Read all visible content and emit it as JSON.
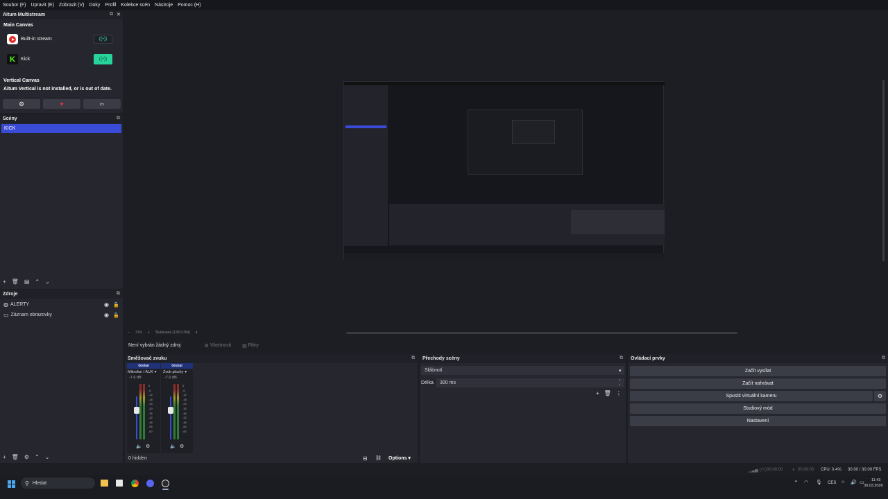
{
  "menubar": {
    "items": [
      "Soubor (F)",
      "Upravit (E)",
      "Zobrazit (V)",
      "Doky",
      "Profil",
      "Kolekce scén",
      "Nástroje",
      "Pomoc (H)"
    ]
  },
  "multistream": {
    "title": "Aitum Multistream",
    "main_canvas_label": "Main Canvas",
    "outputs": [
      {
        "name": "Built-in stream",
        "icon": "youtube-icon",
        "active": false
      },
      {
        "name": "Kick",
        "icon": "kick-icon",
        "active": true
      }
    ],
    "vertical_canvas_label": "Vertical Canvas",
    "vertical_warning": "Aitum Vertical is not installed, or is out of date.",
    "bottom_icons": [
      "gear-icon",
      "heart-icon",
      "share-icon"
    ],
    "accent": "#27d49b"
  },
  "scenes": {
    "title": "Scény",
    "items": [
      "KICK"
    ],
    "selected": "KICK",
    "selected_color": "#3a4bd8"
  },
  "sources": {
    "title": "Zdroje",
    "items": [
      {
        "name": "ALERTY",
        "icon": "globe-icon"
      },
      {
        "name": "Záznam obrazovky",
        "icon": "monitor-icon"
      }
    ]
  },
  "preview": {
    "zoom": "72%",
    "scale_label": "Škálovaná (1367x769)"
  },
  "source_bar": {
    "no_source": "Není vybrán žádný zdroj",
    "properties": "Vlastnosti",
    "filters": "Filtry"
  },
  "mixer": {
    "title": "Směšovač zvuku",
    "channels": [
      {
        "tag": "Global",
        "name": "Mikrofon / AUX",
        "db": "-7.6 dB"
      },
      {
        "tag": "Global",
        "name": "Zvuk plochy",
        "db": "-7.0 dB"
      }
    ],
    "scale": [
      "0",
      "-6",
      "-12",
      "-18",
      "-24",
      "-30",
      "-36",
      "-42",
      "-48",
      "-54",
      "-60"
    ],
    "hidden": "0 hidden",
    "options": "Options"
  },
  "transitions": {
    "title": "Přechody scény",
    "type": "Slábnutí",
    "duration_label": "Délka",
    "duration_value": "300 ms"
  },
  "controls": {
    "title": "Ovládací prvky",
    "buttons": [
      "Začít vysílat",
      "Začít nahrávat",
      "Spustit virtuální kameru",
      "Studiový mód",
      "Nastavení"
    ]
  },
  "status": {
    "stream_time": "00:00:00",
    "rec_time": "00:00:00",
    "cpu": "CPU: 0.4%",
    "fps": "30.00 / 30.00 FPS"
  },
  "taskbar": {
    "search": "Hledat",
    "lang": "CES",
    "time": "11:43",
    "date": "30.03.2026"
  }
}
